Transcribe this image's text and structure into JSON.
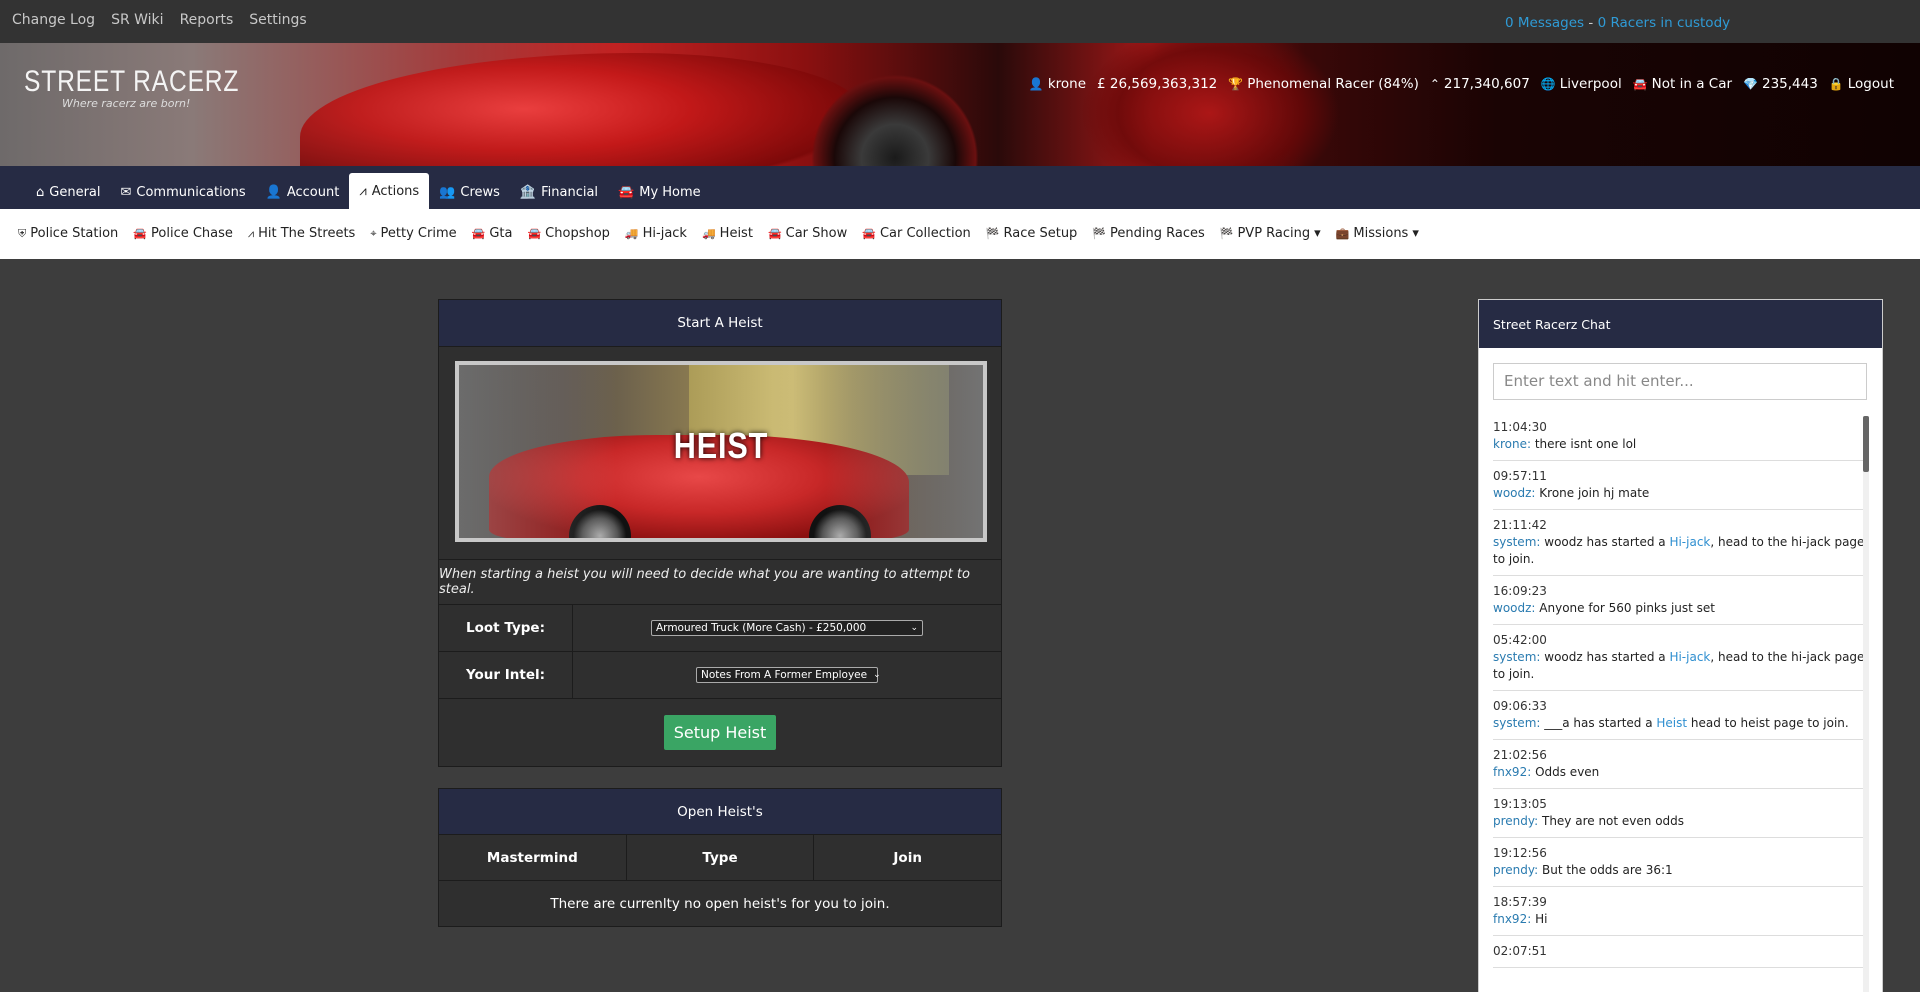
{
  "topbar": {
    "links": [
      "Change Log",
      "SR Wiki",
      "Reports",
      "Settings"
    ],
    "messages": "0 Messages",
    "separator": " - ",
    "custody": "0 Racers in custody"
  },
  "brand": {
    "title": "STREET RACERZ",
    "tagline": "Where racerz are born!"
  },
  "stats": {
    "user": "krone",
    "money": "£ 26,569,363,312",
    "rank": "Phenomenal Racer (84%)",
    "exp": "217,340,607",
    "location": "Liverpool",
    "car": "Not in a Car",
    "points": "235,443",
    "logout": "Logout"
  },
  "mainnav": {
    "tabs": [
      "General",
      "Communications",
      "Account",
      "Actions",
      "Crews",
      "Financial",
      "My Home"
    ],
    "active": "Actions"
  },
  "subnav": {
    "items": [
      "Police Station",
      "Police Chase",
      "Hit The Streets",
      "Petty Crime",
      "Gta",
      "Chopshop",
      "Hi-jack",
      "Heist",
      "Car Show",
      "Car Collection",
      "Race Setup",
      "Pending Races",
      "PVP Racing",
      "Missions"
    ]
  },
  "heist": {
    "title": "Start A Heist",
    "image_word": "HEIST",
    "description": "When starting a heist you will need to decide what you are wanting to attempt to steal.",
    "loot_label": "Loot Type:",
    "loot_value": "Armoured Truck (More Cash) - £250,000",
    "intel_label": "Your Intel:",
    "intel_value": "Notes From A Former Employee",
    "button": "Setup Heist"
  },
  "open": {
    "title": "Open Heist's",
    "cols": [
      "Mastermind",
      "Type",
      "Join"
    ],
    "empty": "There are currenlty no open heist's for you to join."
  },
  "chat": {
    "title": "Street Racerz Chat",
    "placeholder": "Enter text and hit enter...",
    "messages": [
      {
        "time": "11:04:30",
        "user": "krone",
        "pre": " there isnt one lol",
        "link": "",
        "post": ""
      },
      {
        "time": "09:57:11",
        "user": "woodz",
        "pre": " Krone join hj mate",
        "link": "",
        "post": ""
      },
      {
        "time": "21:11:42",
        "user": "system",
        "pre": " woodz has started a ",
        "link": "Hi-jack",
        "post": ", head to the hi-jack page to join."
      },
      {
        "time": "16:09:23",
        "user": "woodz",
        "pre": " Anyone for 560 pinks just set",
        "link": "",
        "post": ""
      },
      {
        "time": "05:42:00",
        "user": "system",
        "pre": " woodz has started a ",
        "link": "Hi-jack",
        "post": ", head to the hi-jack page to join."
      },
      {
        "time": "09:06:33",
        "user": "system",
        "pre": " ___a has started a ",
        "link": "Heist",
        "post": " head to heist page to join."
      },
      {
        "time": "21:02:56",
        "user": "fnx92",
        "pre": " Odds even",
        "link": "",
        "post": ""
      },
      {
        "time": "19:13:05",
        "user": "prendy",
        "pre": " They are not even odds",
        "link": "",
        "post": ""
      },
      {
        "time": "19:12:56",
        "user": "prendy",
        "pre": " But the odds are 36:1",
        "link": "",
        "post": ""
      },
      {
        "time": "18:57:39",
        "user": "fnx92",
        "pre": " Hi",
        "link": "",
        "post": ""
      },
      {
        "time": "02:07:51",
        "user": "",
        "pre": "",
        "link": "",
        "post": ""
      }
    ]
  }
}
